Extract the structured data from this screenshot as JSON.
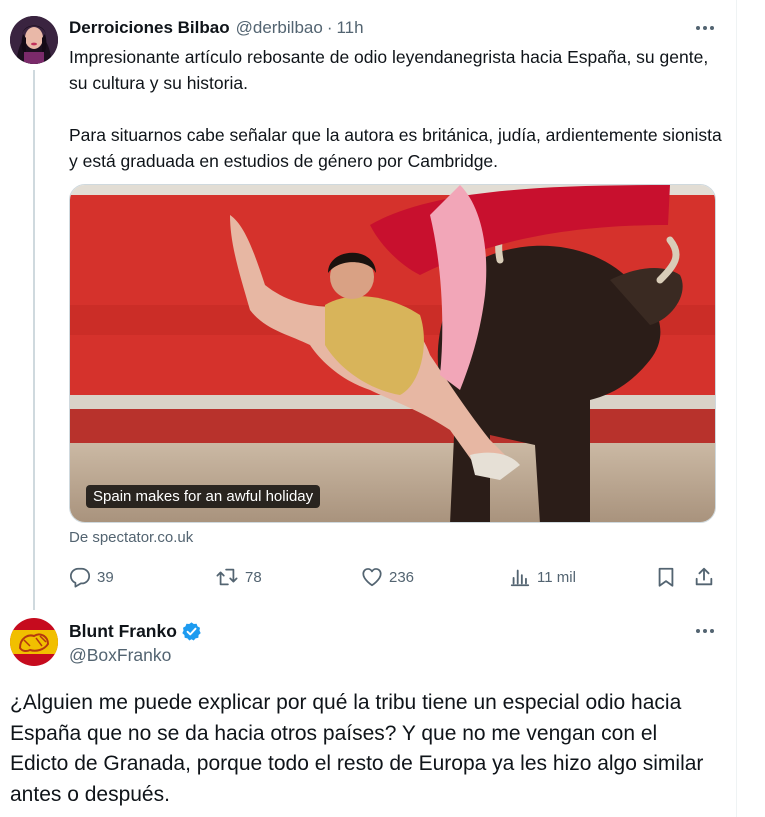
{
  "tweet1": {
    "author_name": "Derroiciones Bilbao",
    "handle": "@derbilbao",
    "separator": "·",
    "time": "11h",
    "text_paragraphs": [
      "Impresionante artículo rebosante de odio leyendanegrista hacia España, su gente, su cultura y su historia.",
      "Para situarnos cabe señalar que la autora es británica, judía, ardientemente sionista y está graduada en estudios de género por Cambridge."
    ],
    "media": {
      "caption": "Spain makes for an awful holiday"
    },
    "source": "De spectator.co.uk",
    "actions": {
      "replies": "39",
      "retweets": "78",
      "likes": "236",
      "views": "11 mil"
    }
  },
  "tweet2": {
    "author_name": "Blunt Franko",
    "handle": "@BoxFranko",
    "text": "¿Alguien me puede explicar por qué la tribu tiene un especial odio hacia España que no se da hacia otros países? Y que no me vengan con el Edicto de Granada, porque todo el resto de Europa ya les hizo algo similar antes o después."
  },
  "colors": {
    "text": "#0f1419",
    "muted": "#536471",
    "verified": "#1d9bf0",
    "thread_line": "#cfd9de"
  }
}
